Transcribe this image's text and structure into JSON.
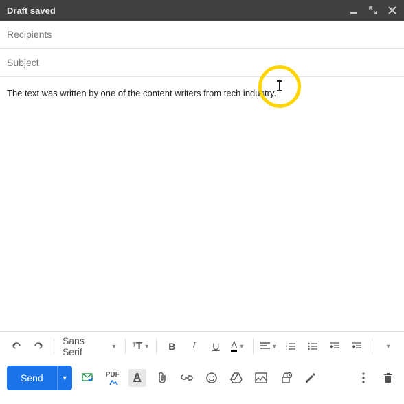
{
  "header": {
    "title": "Draft saved"
  },
  "fields": {
    "recipients_placeholder": "Recipients",
    "subject_placeholder": "Subject"
  },
  "body": {
    "text": "The text was written by one of the content writers from tech industry."
  },
  "toolbar": {
    "font": "Sans Serif",
    "size_label": "T",
    "bold": "B",
    "italic": "I",
    "underline": "U",
    "textcolor": "A",
    "align": "≡"
  },
  "bottom": {
    "send_label": "Send",
    "pdf_label": "PDF"
  }
}
